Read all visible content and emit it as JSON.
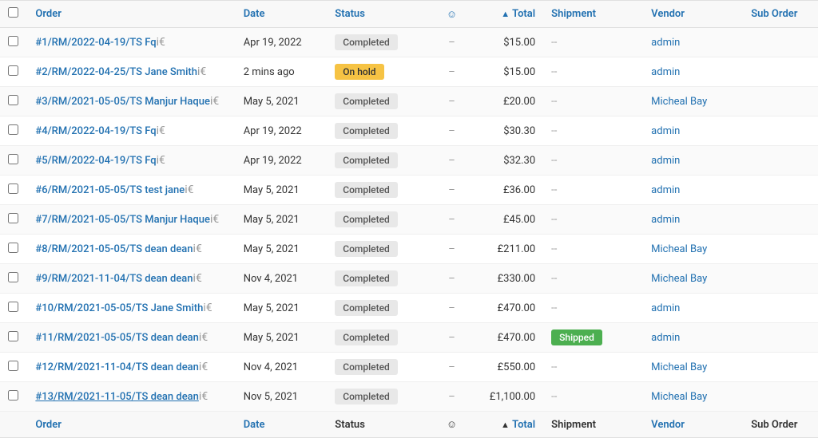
{
  "colors": {
    "link": "#2271b1",
    "completed_bg": "#e8e8e8",
    "completed_text": "#555",
    "onhold_bg": "#f6c344",
    "onhold_text": "#333",
    "shipped_bg": "#4caf50",
    "shipped_text": "#fff"
  },
  "header": {
    "col_checkbox": "",
    "col_order": "Order",
    "col_date": "Date",
    "col_status": "Status",
    "col_icon": "☺",
    "col_total": "Total",
    "col_total_sort": "▲",
    "col_shipment": "Shipment",
    "col_vendor": "Vendor",
    "col_suborder": "Sub Order"
  },
  "footer": {
    "col_order": "Order",
    "col_date": "Date",
    "col_status": "Status",
    "col_icon": "☺",
    "col_total": "Total",
    "col_total_sort": "▲",
    "col_shipment": "Shipment",
    "col_vendor": "Vendor",
    "col_suborder": "Sub Order"
  },
  "rows": [
    {
      "id": "row-1",
      "order": "#1/RM/2022-04-19/TS Fq",
      "order_underline": false,
      "icons": "i€",
      "date": "Apr 19, 2022",
      "status": "Completed",
      "status_type": "completed",
      "dash1": "–",
      "total": "$15.00",
      "dash2": "--",
      "vendor": "admin",
      "suborder": ""
    },
    {
      "id": "row-2",
      "order": "#2/RM/2022-04-25/TS Jane Smith",
      "order_underline": false,
      "icons": "i€",
      "date": "2 mins ago",
      "status": "On hold",
      "status_type": "onhold",
      "dash1": "–",
      "total": "$15.00",
      "dash2": "--",
      "vendor": "admin",
      "suborder": ""
    },
    {
      "id": "row-3",
      "order": "#3/RM/2021-05-05/TS Manjur Haque",
      "order_underline": false,
      "icons": "i€",
      "date": "May 5, 2021",
      "status": "Completed",
      "status_type": "completed",
      "dash1": "–",
      "total": "£20.00",
      "dash2": "--",
      "vendor": "Micheal Bay",
      "suborder": ""
    },
    {
      "id": "row-4",
      "order": "#4/RM/2022-04-19/TS Fq",
      "order_underline": false,
      "icons": "i€",
      "date": "Apr 19, 2022",
      "status": "Completed",
      "status_type": "completed",
      "dash1": "–",
      "total": "$30.30",
      "dash2": "--",
      "vendor": "admin",
      "suborder": ""
    },
    {
      "id": "row-5",
      "order": "#5/RM/2022-04-19/TS Fq",
      "order_underline": false,
      "icons": "i€",
      "date": "Apr 19, 2022",
      "status": "Completed",
      "status_type": "completed",
      "dash1": "–",
      "total": "$32.30",
      "dash2": "--",
      "vendor": "admin",
      "suborder": ""
    },
    {
      "id": "row-6",
      "order": "#6/RM/2021-05-05/TS test jane",
      "order_underline": false,
      "icons": "i€",
      "date": "May 5, 2021",
      "status": "Completed",
      "status_type": "completed",
      "dash1": "–",
      "total": "£36.00",
      "dash2": "--",
      "vendor": "admin",
      "suborder": ""
    },
    {
      "id": "row-7",
      "order": "#7/RM/2021-05-05/TS Manjur Haque",
      "order_underline": false,
      "icons": "i€",
      "date": "May 5, 2021",
      "status": "Completed",
      "status_type": "completed",
      "dash1": "–",
      "total": "£45.00",
      "dash2": "--",
      "vendor": "admin",
      "suborder": ""
    },
    {
      "id": "row-8",
      "order": "#8/RM/2021-05-05/TS dean dean",
      "order_underline": false,
      "icons": "i€",
      "date": "May 5, 2021",
      "status": "Completed",
      "status_type": "completed",
      "dash1": "–",
      "total": "£211.00",
      "dash2": "--",
      "vendor": "Micheal Bay",
      "suborder": ""
    },
    {
      "id": "row-9",
      "order": "#9/RM/2021-11-04/TS dean dean",
      "order_underline": false,
      "icons": "i€",
      "date": "Nov 4, 2021",
      "status": "Completed",
      "status_type": "completed",
      "dash1": "–",
      "total": "£330.00",
      "dash2": "--",
      "vendor": "Micheal Bay",
      "suborder": ""
    },
    {
      "id": "row-10",
      "order": "#10/RM/2021-05-05/TS Jane Smith",
      "order_underline": false,
      "icons": "i€",
      "date": "May 5, 2021",
      "status": "Completed",
      "status_type": "completed",
      "dash1": "–",
      "total": "£470.00",
      "dash2": "--",
      "vendor": "admin",
      "suborder": ""
    },
    {
      "id": "row-11",
      "order": "#11/RM/2021-05-05/TS dean dean",
      "order_underline": false,
      "icons": "i€",
      "date": "May 5, 2021",
      "status": "Completed",
      "status_type": "completed",
      "dash1": "–",
      "total": "£470.00",
      "dash2": "Shipped",
      "dash2_type": "shipped",
      "vendor": "admin",
      "suborder": ""
    },
    {
      "id": "row-12",
      "order": "#12/RM/2021-11-04/TS dean dean",
      "order_underline": false,
      "icons": "i€",
      "date": "Nov 4, 2021",
      "status": "Completed",
      "status_type": "completed",
      "dash1": "–",
      "total": "£550.00",
      "dash2": "--",
      "vendor": "Micheal Bay",
      "suborder": ""
    },
    {
      "id": "row-13",
      "order": "#13/RM/2021-11-05/TS dean dean",
      "order_underline": true,
      "icons": "i€",
      "date": "Nov 5, 2021",
      "status": "Completed",
      "status_type": "completed",
      "dash1": "–",
      "total": "£1,100.00",
      "dash2": "--",
      "vendor": "Micheal Bay",
      "suborder": ""
    }
  ]
}
